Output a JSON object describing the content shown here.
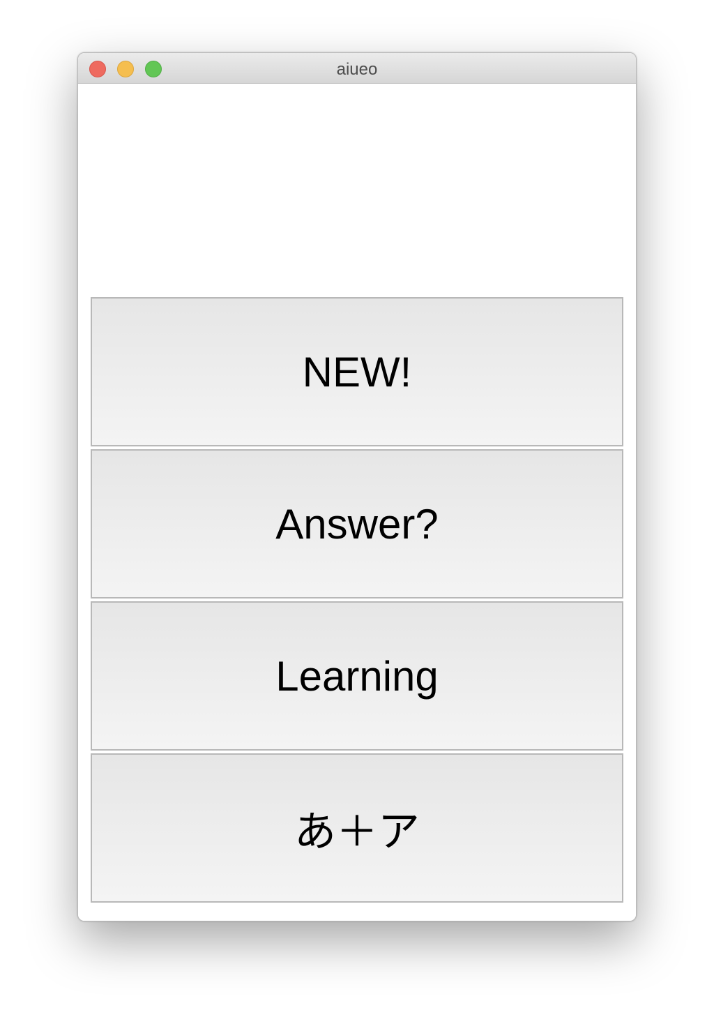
{
  "window": {
    "title": "aiueo"
  },
  "buttons": {
    "new_label": "NEW!",
    "answer_label": "Answer?",
    "learning_label": "Learning",
    "kana_label": "あ＋ア"
  }
}
